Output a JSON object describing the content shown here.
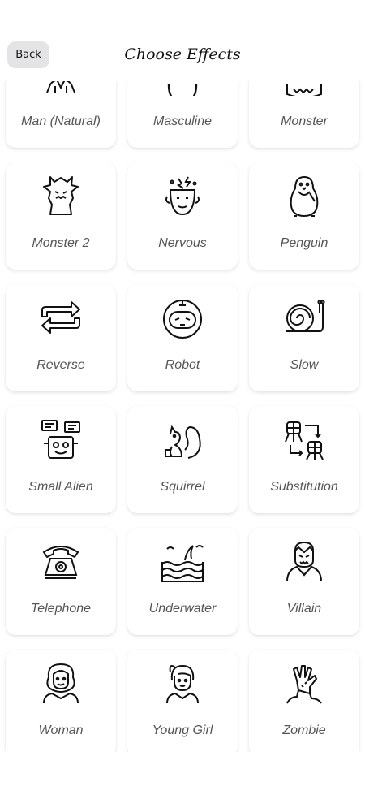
{
  "header": {
    "back_label": "Back",
    "title": "Choose Effects"
  },
  "effects": [
    {
      "label": "Man (Natural)",
      "icon": "man-icon"
    },
    {
      "label": "Masculine",
      "icon": "masculine-icon"
    },
    {
      "label": "Monster",
      "icon": "monster-icon"
    },
    {
      "label": "Monster 2",
      "icon": "tree-monster-icon"
    },
    {
      "label": "Nervous",
      "icon": "nervous-head-icon"
    },
    {
      "label": "Penguin",
      "icon": "penguin-icon"
    },
    {
      "label": "Reverse",
      "icon": "reverse-arrows-icon"
    },
    {
      "label": "Robot",
      "icon": "robot-icon"
    },
    {
      "label": "Slow",
      "icon": "snail-icon"
    },
    {
      "label": "Small Alien",
      "icon": "small-alien-icon"
    },
    {
      "label": "Squirrel",
      "icon": "squirrel-icon"
    },
    {
      "label": "Substitution",
      "icon": "substitution-icon"
    },
    {
      "label": "Telephone",
      "icon": "telephone-icon"
    },
    {
      "label": "Underwater",
      "icon": "underwater-icon"
    },
    {
      "label": "Villain",
      "icon": "villain-icon"
    },
    {
      "label": "Woman",
      "icon": "woman-icon"
    },
    {
      "label": "Young Girl",
      "icon": "young-girl-icon"
    },
    {
      "label": "Zombie",
      "icon": "zombie-hand-icon"
    }
  ]
}
